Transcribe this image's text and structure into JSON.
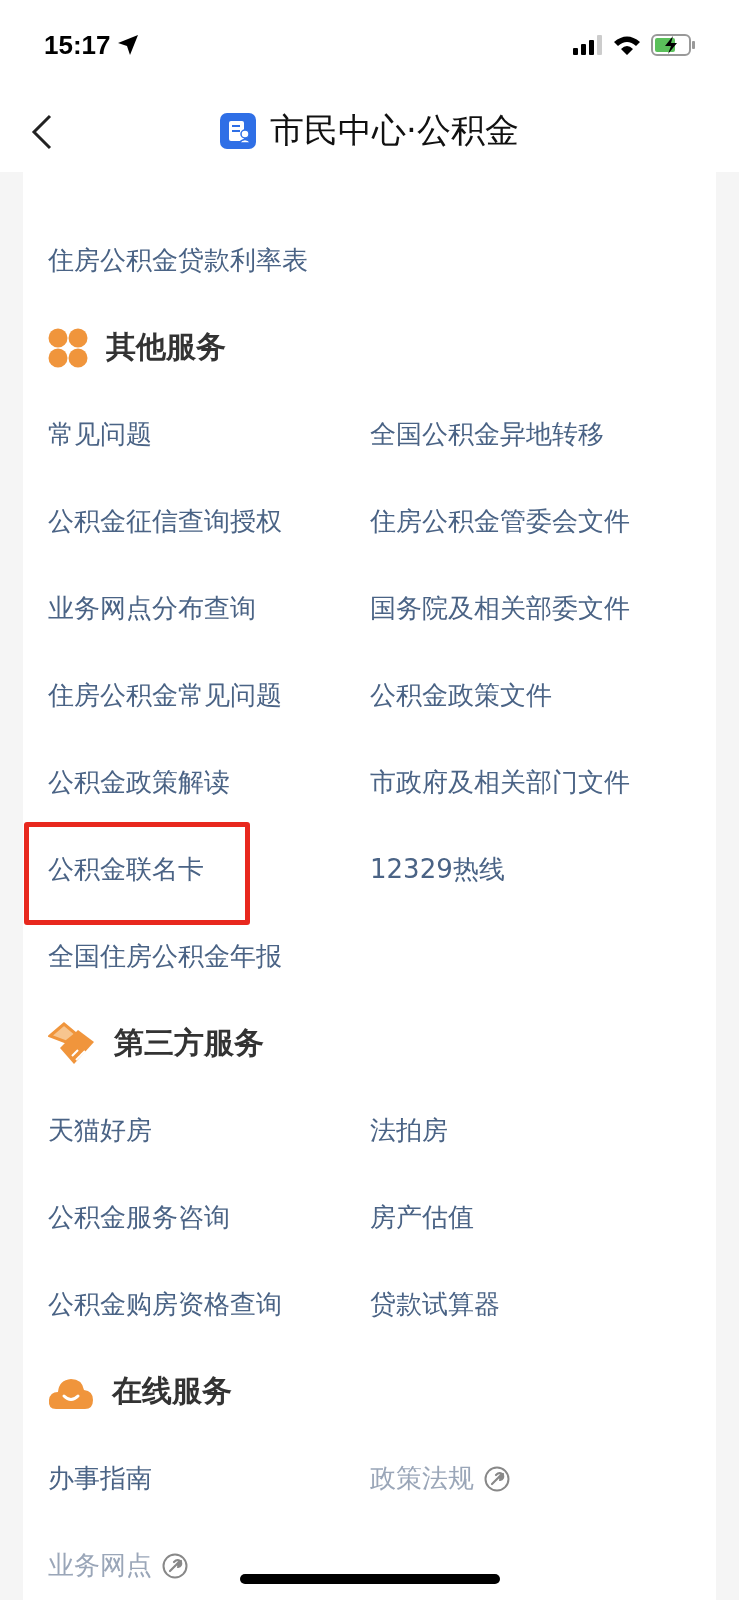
{
  "status_bar": {
    "time": "15:17"
  },
  "nav_bar": {
    "title": "市民中心·公积金"
  },
  "sections": [
    {
      "items": [
        {
          "label": "住房公积金贷款利率表",
          "disabled": false,
          "highlighted": false
        }
      ]
    },
    {
      "title": "其他服务",
      "kind": "clover",
      "items": [
        {
          "label": "常见问题",
          "disabled": false,
          "highlighted": false
        },
        {
          "label": "全国公积金异地转移",
          "disabled": false,
          "highlighted": false
        },
        {
          "label": "公积金征信查询授权",
          "disabled": false,
          "highlighted": false
        },
        {
          "label": "住房公积金管委会文件",
          "disabled": false,
          "highlighted": false
        },
        {
          "label": "业务网点分布查询",
          "disabled": false,
          "highlighted": false
        },
        {
          "label": "国务院及相关部委文件",
          "disabled": false,
          "highlighted": false
        },
        {
          "label": "住房公积金常见问题",
          "disabled": false,
          "highlighted": false
        },
        {
          "label": "公积金政策文件",
          "disabled": false,
          "highlighted": false
        },
        {
          "label": "公积金政策解读",
          "disabled": false,
          "highlighted": false
        },
        {
          "label": "市政府及相关部门文件",
          "disabled": false,
          "highlighted": false
        },
        {
          "label": "公积金联名卡",
          "disabled": false,
          "highlighted": true
        },
        {
          "label": "12329热线",
          "disabled": false,
          "highlighted": false
        },
        {
          "label": "全国住房公积金年报",
          "disabled": false,
          "highlighted": false
        }
      ]
    },
    {
      "title": "第三方服务",
      "kind": "handshake",
      "items": [
        {
          "label": "天猫好房",
          "disabled": false,
          "highlighted": false
        },
        {
          "label": "法拍房",
          "disabled": false,
          "highlighted": false
        },
        {
          "label": "公积金服务咨询",
          "disabled": false,
          "highlighted": false
        },
        {
          "label": "房产估值",
          "disabled": false,
          "highlighted": false
        },
        {
          "label": "公积金购房资格查询",
          "disabled": false,
          "highlighted": false
        },
        {
          "label": "贷款试算器",
          "disabled": false,
          "highlighted": false
        }
      ]
    },
    {
      "title": "在线服务",
      "kind": "cloud",
      "items": [
        {
          "label": "办事指南",
          "disabled": false,
          "highlighted": false
        },
        {
          "label": "政策法规",
          "disabled": true,
          "highlighted": false
        },
        {
          "label": "业务网点",
          "disabled": true,
          "highlighted": false
        }
      ]
    }
  ]
}
